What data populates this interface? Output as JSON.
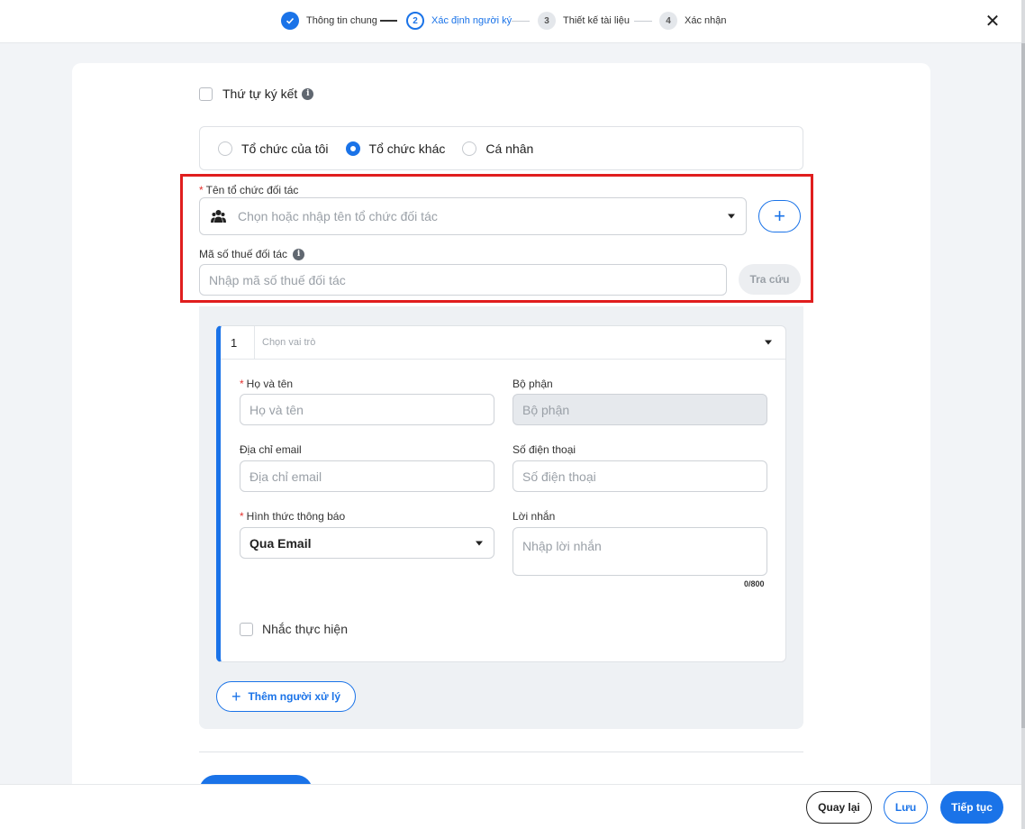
{
  "stepper": {
    "steps": [
      {
        "number": "",
        "label": "Thông tin chung",
        "state": "done"
      },
      {
        "number": "2",
        "label": "Xác định người ký",
        "state": "active"
      },
      {
        "number": "3",
        "label": "Thiết kế tài liệu",
        "state": "pending"
      },
      {
        "number": "4",
        "label": "Xác nhận",
        "state": "pending"
      }
    ],
    "close_glyph": "✕"
  },
  "signing_order": {
    "label": "Thứ tự ký kết",
    "info_glyph": "i",
    "checked": false
  },
  "org_type": {
    "options": [
      "Tổ chức của tôi",
      "Tổ chức khác",
      "Cá nhân"
    ],
    "selected": "Tổ chức khác"
  },
  "partner": {
    "name_label": "Tên tổ chức đối tác",
    "required_mark": "*",
    "name_placeholder": "Chọn hoặc nhập tên tổ chức đối tác",
    "org_icon": "people-icon",
    "add_glyph": "+",
    "tax_label": "Mã số thuế đối tác",
    "tax_info_glyph": "i",
    "tax_placeholder": "Nhập mã số thuế đối tác",
    "lookup_label": "Tra cứu"
  },
  "signer": {
    "index": "1",
    "role_placeholder": "Chọn vai trò",
    "fullname_label": "Họ và tên",
    "fullname_placeholder": "Họ và tên",
    "department_label": "Bộ phận",
    "department_placeholder": "Bộ phận",
    "email_label": "Địa chỉ email",
    "email_placeholder": "Địa chỉ email",
    "phone_label": "Số điện thoại",
    "phone_placeholder": "Số điện thoại",
    "notify_label": "Hình thức thông báo",
    "notify_value": "Qua Email",
    "message_label": "Lời nhắn",
    "message_placeholder": "Nhập lời nhắn",
    "message_counter": "0/800",
    "remind_label": "Nhắc thực hiện",
    "required_mark": "*"
  },
  "add_handler": {
    "glyph": "+",
    "label": "Thêm người xử lý"
  },
  "footer": {
    "back": "Quay lại",
    "save": "Lưu",
    "next": "Tiếp tục"
  },
  "colors": {
    "accent": "#1a73e8",
    "highlight": "#e01e1e",
    "required": "#e5322e"
  }
}
